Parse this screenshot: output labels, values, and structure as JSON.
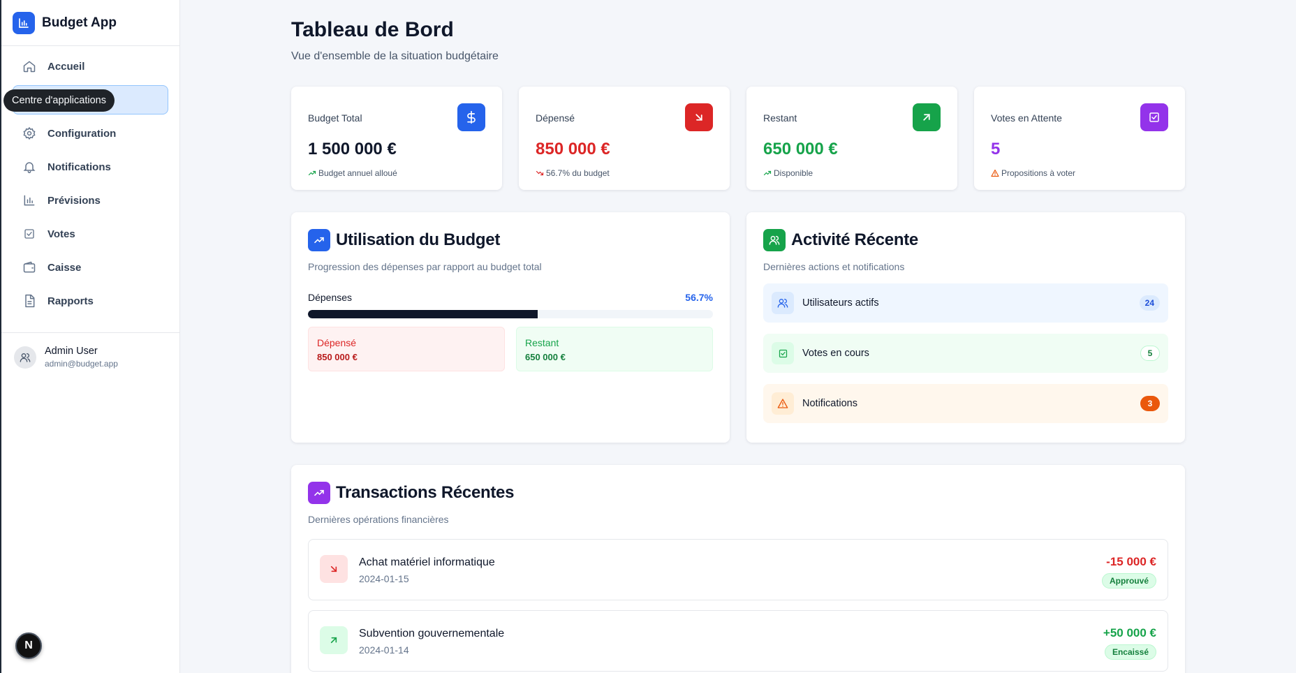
{
  "app": {
    "name": "Budget App",
    "logo_icon": "bar-chart-icon"
  },
  "sidebar": {
    "items": [
      {
        "label": "Accueil",
        "icon": "home-icon"
      },
      {
        "label": "",
        "icon": "grid-icon",
        "active": true
      },
      {
        "label": "Configuration",
        "icon": "gear-icon"
      },
      {
        "label": "Notifications",
        "icon": "bell-icon"
      },
      {
        "label": "Prévisions",
        "icon": "bar-chart-icon"
      },
      {
        "label": "Votes",
        "icon": "vote-icon"
      },
      {
        "label": "Caisse",
        "icon": "wallet-icon"
      },
      {
        "label": "Rapports",
        "icon": "file-icon"
      }
    ],
    "tooltip": "Centre d'applications",
    "user": {
      "name": "Admin User",
      "email": "admin@budget.app"
    },
    "dev_badge": "N"
  },
  "header": {
    "title": "Tableau de Bord",
    "subtitle": "Vue d'ensemble de la situation budgétaire"
  },
  "stats": [
    {
      "label": "Budget Total",
      "value": "1 500 000 €",
      "note": "Budget annuel alloué",
      "icon": "dollar-icon",
      "color": "#2563eb",
      "value_color": "#0f172a"
    },
    {
      "label": "Dépensé",
      "value": "850 000 €",
      "note": "56.7% du budget",
      "icon": "arrow-down-right-icon",
      "color": "#dc2626",
      "value_color": "#dc2626"
    },
    {
      "label": "Restant",
      "value": "650 000 €",
      "note": "Disponible",
      "icon": "arrow-up-right-icon",
      "color": "#16a34a",
      "value_color": "#16a34a"
    },
    {
      "label": "Votes en Attente",
      "value": "5",
      "note": "Propositions à voter",
      "icon": "vote-icon",
      "color": "#9333ea",
      "value_color": "#9333ea"
    }
  ],
  "usage": {
    "title": "Utilisation du Budget",
    "subtitle": "Progression des dépenses par rapport au budget total",
    "progress_label": "Dépenses",
    "progress_percent_text": "56.7%",
    "progress_fraction": 0.567,
    "spent": {
      "label": "Dépensé",
      "value": "850 000 €"
    },
    "remaining": {
      "label": "Restant",
      "value": "650 000 €"
    }
  },
  "activity": {
    "title": "Activité Récente",
    "subtitle": "Dernières actions et notifications",
    "items": [
      {
        "label": "Utilisateurs actifs",
        "count": "24",
        "icon": "users-icon"
      },
      {
        "label": "Votes en cours",
        "count": "5",
        "icon": "vote-icon"
      },
      {
        "label": "Notifications",
        "count": "3",
        "icon": "warning-icon"
      }
    ]
  },
  "transactions": {
    "title": "Transactions Récentes",
    "subtitle": "Dernières opérations financières",
    "items": [
      {
        "title": "Achat matériel informatique",
        "date": "2024-01-15",
        "amount": "-15 000 €",
        "status": "Approuvé",
        "icon": "arrow-down-right-icon"
      },
      {
        "title": "Subvention gouvernementale",
        "date": "2024-01-14",
        "amount": "+50 000 €",
        "status": "Encaissé",
        "icon": "arrow-up-right-icon"
      }
    ]
  }
}
